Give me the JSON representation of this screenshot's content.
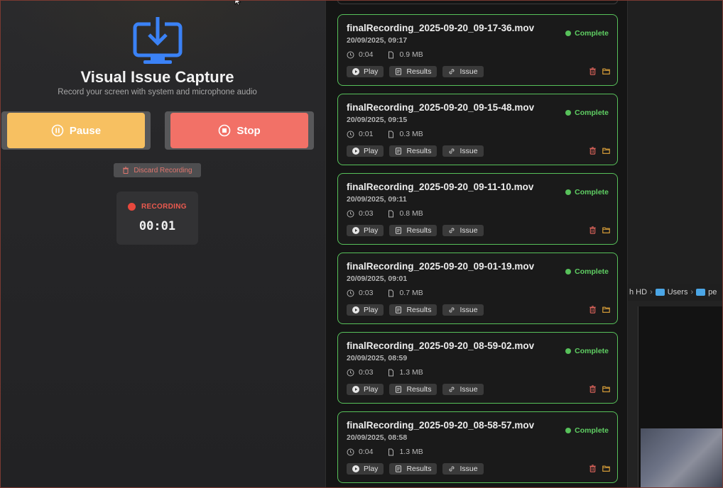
{
  "app": {
    "title": "Visual Issue Capture",
    "subtitle": "Record your screen with system and microphone audio",
    "icon": "download-to-screen-icon",
    "accent_color": "#3b82f6"
  },
  "controls": {
    "pause_label": "Pause",
    "stop_label": "Stop",
    "discard_label": "Discard Recording",
    "pause_color": "#f7c061",
    "stop_color": "#f27167"
  },
  "recording": {
    "status": "RECORDING",
    "elapsed": "00:01",
    "status_color": "#e8483d"
  },
  "recordings": [
    {
      "name": "finalRecording_2025-09-20_09-17-36.mov",
      "date": "20/09/2025, 09:17",
      "duration": "0:04",
      "size": "0.9 MB",
      "status": "Complete"
    },
    {
      "name": "finalRecording_2025-09-20_09-15-48.mov",
      "date": "20/09/2025, 09:15",
      "duration": "0:01",
      "size": "0.3 MB",
      "status": "Complete"
    },
    {
      "name": "finalRecording_2025-09-20_09-11-10.mov",
      "date": "20/09/2025, 09:11",
      "duration": "0:03",
      "size": "0.8 MB",
      "status": "Complete"
    },
    {
      "name": "finalRecording_2025-09-20_09-01-19.mov",
      "date": "20/09/2025, 09:01",
      "duration": "0:03",
      "size": "0.7 MB",
      "status": "Complete"
    },
    {
      "name": "finalRecording_2025-09-20_08-59-02.mov",
      "date": "20/09/2025, 08:59",
      "duration": "0:03",
      "size": "1.3 MB",
      "status": "Complete"
    },
    {
      "name": "finalRecording_2025-09-20_08-58-57.mov",
      "date": "20/09/2025, 08:58",
      "duration": "0:04",
      "size": "1.3 MB",
      "status": "Complete"
    }
  ],
  "card_actions": {
    "play_label": "Play",
    "results_label": "Results",
    "issue_label": "Issue",
    "complete_color": "#57c15a"
  },
  "background_window": {
    "breadcrumb": [
      "h HD",
      "Users",
      "pe"
    ]
  }
}
